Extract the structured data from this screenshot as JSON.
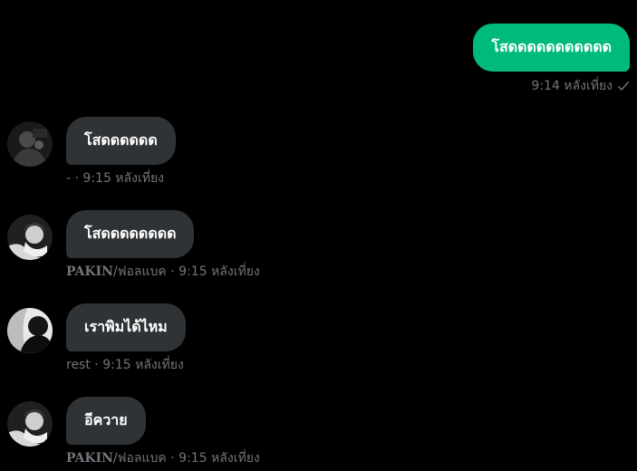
{
  "outgoing": {
    "text": "โสดดดดดดดดดดด",
    "time": "9:14 หลังเที่ยง",
    "status_icon": "check-icon"
  },
  "incoming": [
    {
      "text": "โสดดดดดด",
      "sender": "-",
      "separator": " · ",
      "time": "9:15 หลังเที่ยง",
      "avatar": "avatar-dark-figure"
    },
    {
      "text": "โสดดดดดดดด",
      "sender": "PAKIN",
      "sender_suffix": "/ฟอลแบค",
      "separator": " · ",
      "time": "9:15 หลังเที่ยง",
      "avatar": "avatar-bw-person"
    },
    {
      "text": "เราพิมได้ไหม",
      "sender": "rest",
      "separator": " · ",
      "time": "9:15 หลังเที่ยง",
      "avatar": "avatar-shadow-portrait"
    },
    {
      "text": "อีควาย",
      "sender": "PAKIN",
      "sender_suffix": "/ฟอลแบค",
      "separator": " · ",
      "time": "9:15 หลังเที่ยง",
      "avatar": "avatar-bw-person"
    }
  ],
  "colors": {
    "background": "#000000",
    "outgoing_bubble": "#00ba7c",
    "incoming_bubble": "#2f3336",
    "meta_text": "#71767b"
  }
}
